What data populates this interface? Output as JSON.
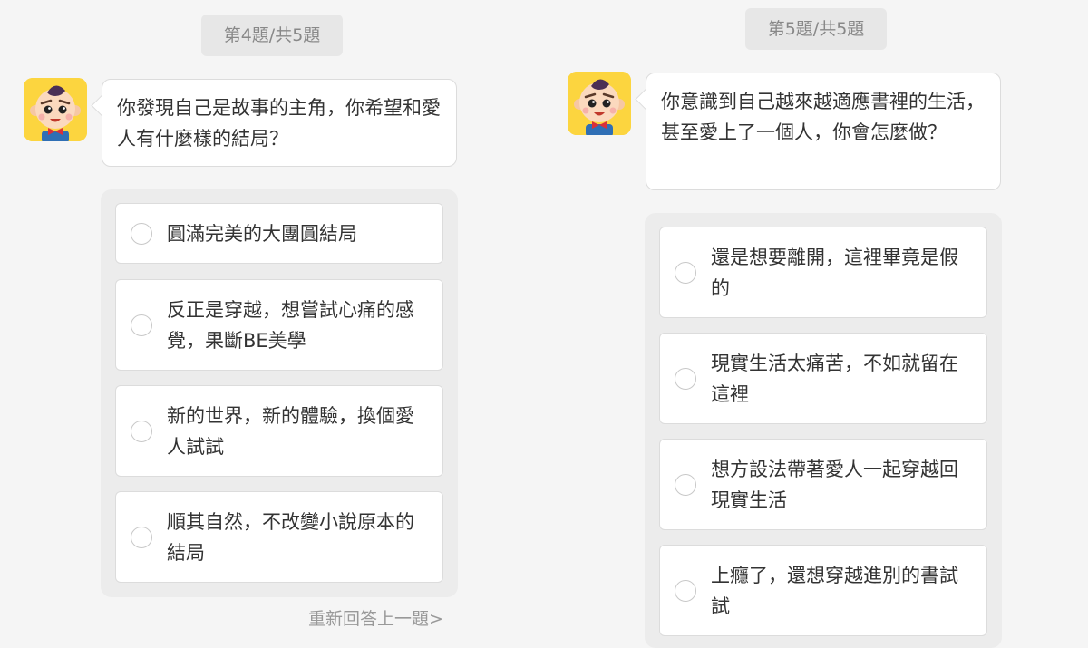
{
  "left": {
    "counter": "第4題/共5題",
    "question": "你發現自己是故事的主角，你希望和愛人有什麼樣的結局？",
    "options": [
      {
        "label": "圓滿完美的大團圓結局"
      },
      {
        "label": "反正是穿越，想嘗試心痛的感覺，果斷BE美學"
      },
      {
        "label": "新的世界，新的體驗，換個愛人試試"
      },
      {
        "label": "順其自然，不改變小說原本的結局"
      }
    ],
    "redo_label": "重新回答上一題>"
  },
  "right": {
    "counter": "第5題/共5題",
    "question": "你意識到自己越來越適應書裡的生活，甚至愛上了一個人，你會怎麼做？",
    "options": [
      {
        "label": "還是想要離開，這裡畢竟是假的"
      },
      {
        "label": "現實生活太痛苦，不如就留在這裡"
      },
      {
        "label": "想方設法帶著愛人一起穿越回現實生活"
      },
      {
        "label": "上癮了，還想穿越進別的書試試"
      }
    ]
  },
  "avatar_icon": "boy-character-icon",
  "colors": {
    "background": "#f5f5f5",
    "avatar_bg": "#fcd53f",
    "options_box": "#ececec"
  }
}
